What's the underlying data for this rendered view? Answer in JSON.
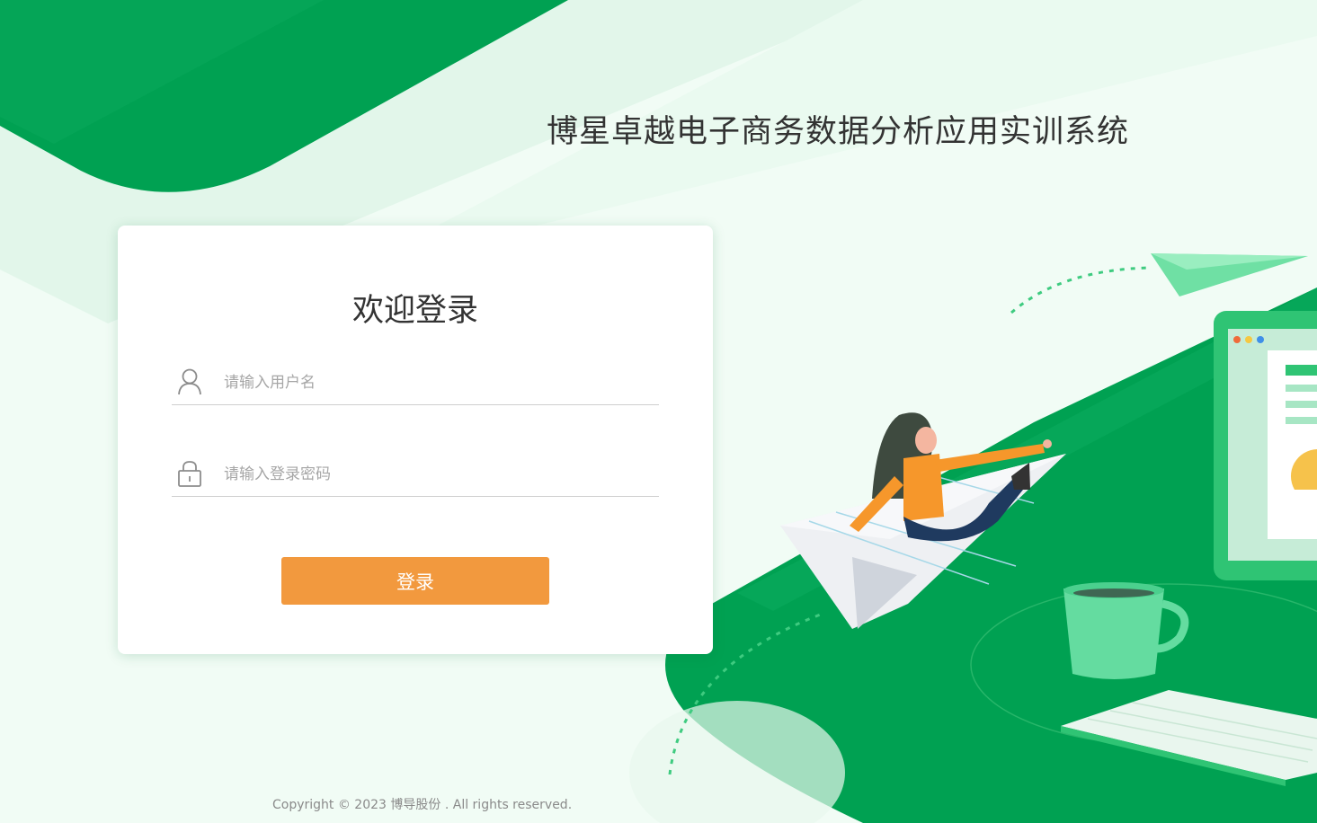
{
  "header": {
    "system_title": "博星卓越电子商务数据分析应用实训系统"
  },
  "login": {
    "title": "欢迎登录",
    "username_placeholder": "请输入用户名",
    "password_placeholder": "请输入登录密码",
    "submit_label": "登录"
  },
  "footer": {
    "copyright": "Copyright © 2023 博导股份 . All rights reserved."
  },
  "icons": {
    "username": "user-icon",
    "password": "lock-icon"
  },
  "colors": {
    "brand_green": "#00a152",
    "button_orange": "#f2993e"
  }
}
